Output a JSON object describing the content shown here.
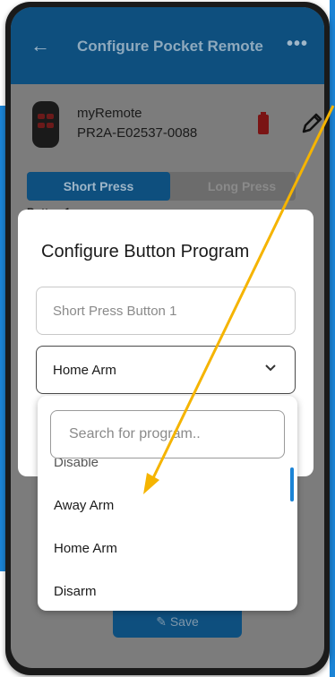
{
  "appbar": {
    "title": "Configure Pocket Remote",
    "back_icon": "arrow-left-icon",
    "more_icon": "more-dots-icon"
  },
  "remote": {
    "name": "myRemote",
    "id": "PR2A-E02537-0088",
    "battery_color": "#7a1414"
  },
  "tabs": [
    {
      "label": "Short Press",
      "active": true
    },
    {
      "label": "Long Press",
      "active": false
    }
  ],
  "section_label": "Button 1",
  "dialog": {
    "title": "Configure Button Program",
    "name_placeholder": "Short Press Button 1",
    "selected_program": "Home Arm"
  },
  "dropdown": {
    "search_placeholder": "Search for program..",
    "options": [
      "Disable",
      "Away Arm",
      "Home Arm",
      "Disarm"
    ]
  },
  "save_button": {
    "label": "Save"
  },
  "colors": {
    "accent": "#0e4f7e",
    "annotation": "#f5b400",
    "highlight": "#1b84d6"
  }
}
